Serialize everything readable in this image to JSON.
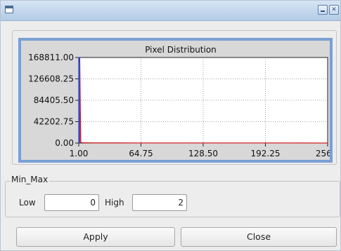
{
  "window": {
    "title": ""
  },
  "titlebar": {
    "minimize_icon": "minimize-icon",
    "close_icon": "close-icon"
  },
  "chart_data": {
    "type": "line",
    "title": "Pixel Distribution",
    "xlabel": "",
    "ylabel": "",
    "xlim": [
      1.0,
      256.0
    ],
    "ylim": [
      0.0,
      168811.0
    ],
    "x_ticks": [
      "1.00",
      "64.75",
      "128.50",
      "192.25",
      "256.0"
    ],
    "y_ticks": [
      "168811.00",
      "126608.25",
      "84405.50",
      "42202.75",
      "0.00"
    ],
    "grid": true,
    "series": [
      {
        "color": "#d02020",
        "x": [
          1,
          2,
          3,
          4,
          5,
          6,
          8,
          10,
          20,
          40,
          60,
          80,
          100,
          128,
          160,
          192,
          224,
          256
        ],
        "y": [
          168811,
          160000,
          1200,
          900,
          600,
          500,
          400,
          350,
          300,
          250,
          200,
          200,
          180,
          150,
          120,
          100,
          80,
          60
        ]
      },
      {
        "color": "#3040c8",
        "x": [
          1,
          1,
          2,
          2
        ],
        "y": [
          0,
          168811,
          168811,
          0
        ]
      }
    ]
  },
  "min_max": {
    "group_label": "Min_Max",
    "low_label": "Low",
    "low_value": "0",
    "high_label": "High",
    "high_value": "2"
  },
  "buttons": {
    "apply": "Apply",
    "close": "Close"
  }
}
